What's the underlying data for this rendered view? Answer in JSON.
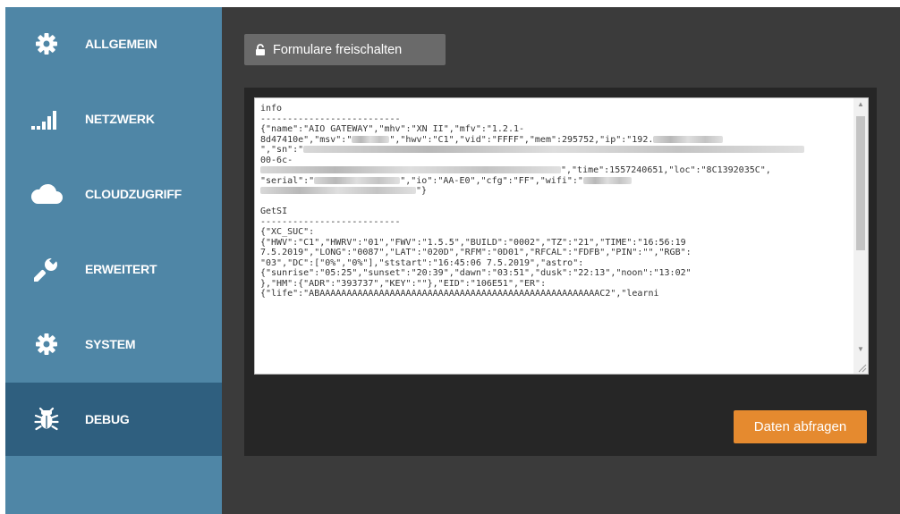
{
  "sidebar": {
    "items": [
      {
        "label": "ALLGEMEIN",
        "icon": "gear-icon"
      },
      {
        "label": "NETZWERK",
        "icon": "signal-bars-icon"
      },
      {
        "label": "CLOUDZUGRIFF",
        "icon": "cloud-icon"
      },
      {
        "label": "ERWEITERT",
        "icon": "wrench-icon"
      },
      {
        "label": "SYSTEM",
        "icon": "gear-icon"
      },
      {
        "label": "DEBUG",
        "icon": "bug-icon",
        "active": true
      }
    ]
  },
  "toolbar": {
    "unlock_label": "Formulare freischalten"
  },
  "debug": {
    "lines": [
      "info",
      "--------------------------",
      "{\"name\":\"AIO GATEWAY\",\"mhv\":\"XN II\",\"mfv\":\"1.2.1-",
      "8d47410e\",\"msv\":\"",
      "\",\"hwv\":\"C1\",\"vid\":\"FFFF\",\"mem\":295752,\"ip\":\"192.",
      "\",\"sn\":\"",
      "00-6c-",
      "\",\"time\":1557240651,\"loc\":\"8C1392035C\",",
      "\"serial\":\"",
      "\",\"io\":\"AA-E0\",\"cfg\":\"FF\",\"wifi\":\"",
      "\"}",
      "",
      "GetSI",
      "--------------------------",
      "{\"XC_SUC\":",
      "{\"HWV\":\"C1\",\"HWRV\":\"01\",\"FWV\":\"1.5.5\",\"BUILD\":\"0002\",\"TZ\":\"21\",\"TIME\":\"16:56:19",
      "7.5.2019\",\"LONG\":\"0087\",\"LAT\":\"020D\",\"RFM\":\"0D01\",\"RFCAL\":\"FDFB\",\"PIN\":\"\",\"RGB\":",
      "\"03\",\"DC\":[\"0%\",\"0%\"],\"ststart\":\"16:45:06 7.5.2019\",\"astro\":",
      "{\"sunrise\":\"05:25\",\"sunset\":\"20:39\",\"dawn\":\"03:51\",\"dusk\":\"22:13\",\"noon\":\"13:02\"",
      "},\"HM\":{\"ADR\":\"393737\",\"KEY\":\"\"},\"EID\":\"106E51\",\"ER\":",
      "{\"life\":\"ABAAAAAAAAAAAAAAAAAAAAAAAAAAAAAAAAAAAAAAAAAAAAAAAAAAAAC2\",\"learni"
    ]
  },
  "actions": {
    "fetch_label": "Daten abfragen"
  },
  "colors": {
    "sidebar": "#4f86a6",
    "sidebar_active": "#2f5f7f",
    "main_bg": "#3b3b3b",
    "panel_bg": "#262626",
    "button_grey": "#6a6a6a",
    "button_orange": "#e58a2f"
  }
}
